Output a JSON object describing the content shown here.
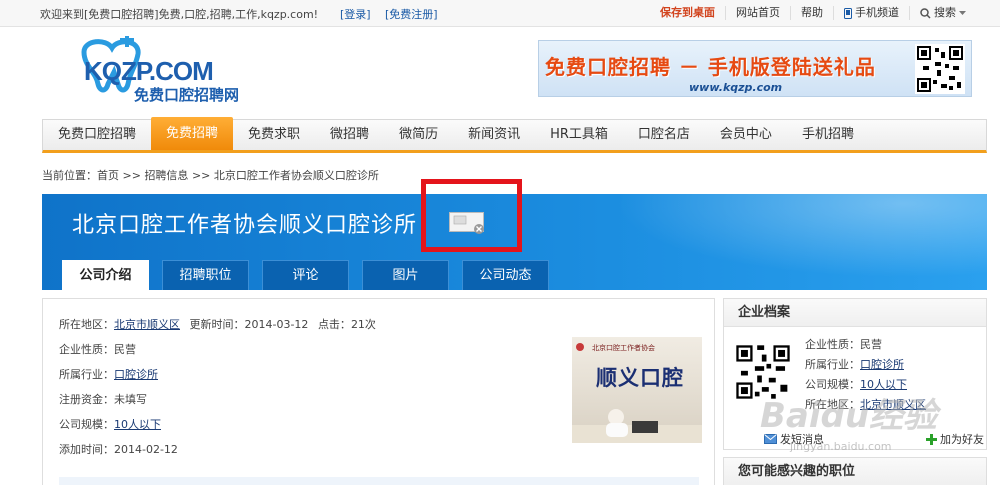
{
  "topbar": {
    "welcome": "欢迎来到[免费口腔招聘]免费,口腔,招聘,工作,kqzp.com!",
    "login": "[登录]",
    "register": "[免费注册]",
    "save_desktop": "保存到桌面",
    "site_home": "网站首页",
    "help": "帮助",
    "mobile_channel": "手机频道",
    "search": "搜索"
  },
  "logo": {
    "brand": "KQZP.COM",
    "tagline": "免费口腔招聘网"
  },
  "banner": {
    "text": "免费口腔招聘 － 手机版登陆送礼品",
    "url": "www.kqzp.com"
  },
  "nav": {
    "items": [
      "免费口腔招聘",
      "免费招聘",
      "免费求职",
      "微招聘",
      "微简历",
      "新闻资讯",
      "HR工具箱",
      "口腔名店",
      "会员中心",
      "手机招聘"
    ],
    "active_index": 1
  },
  "breadcrumb": {
    "prefix": "当前位置：",
    "home": "首页",
    "section": "招聘信息",
    "current": "北京口腔工作者协会顺义口腔诊所"
  },
  "company": {
    "name": "北京口腔工作者协会顺义口腔诊所",
    "tabs": [
      "公司介绍",
      "招聘职位",
      "评论",
      "图片",
      "公司动态"
    ],
    "active_tab": 0
  },
  "info": {
    "region_label": "所在地区：",
    "region": "北京市顺义区",
    "update_label": "更新时间：",
    "update": "2014-03-12",
    "clicks_label": "点击：",
    "clicks": "21次",
    "nature_label": "企业性质：",
    "nature": "民营",
    "industry_label": "所属行业：",
    "industry": "口腔诊所",
    "capital_label": "注册资金：",
    "capital": "未填写",
    "size_label": "公司规模：",
    "size": "10人以下",
    "added_label": "添加时间：",
    "added": "2014-02-12"
  },
  "photo": {
    "sign": "顺义口腔",
    "small": "北京口腔工作者协会"
  },
  "side": {
    "title": "企业档案",
    "nature_label": "企业性质：",
    "nature": "民营",
    "industry_label": "所属行业：",
    "industry": "口腔诊所",
    "size_label": "公司规模：",
    "size": "10人以下",
    "region_label": "所在地区：",
    "region": "北京市顺义区",
    "send_message": "发短消息",
    "add_friend": "加为好友",
    "related_title": "您可能感兴趣的职位"
  },
  "watermark": {
    "text": "Baidu经验",
    "url": "jingyan.baidu.com"
  },
  "colors": {
    "accent_orange": "#f29f1c",
    "banner_blue": "#1c8ee0",
    "highlight_red": "#e4141b",
    "link_blue": "#1a3a73"
  }
}
